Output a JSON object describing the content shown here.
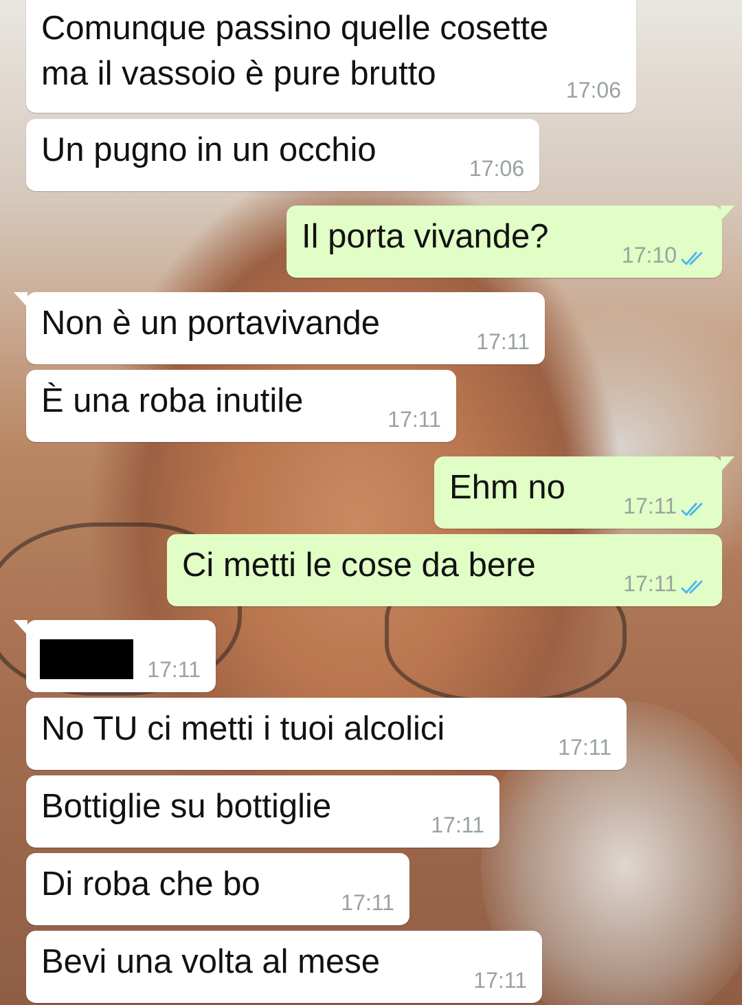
{
  "chat": {
    "colors": {
      "incoming_bubble": "#ffffff",
      "outgoing_bubble": "#e1fec6",
      "read_ticks": "#4fb6ec",
      "timestamp": "#9aa29e"
    },
    "messages": [
      {
        "direction": "in",
        "text": "Comunque passino quelle cosette\nma il vassoio è pure brutto",
        "time": "17:06"
      },
      {
        "direction": "in",
        "text": "Un pugno in un occhio",
        "time": "17:06"
      },
      {
        "direction": "out",
        "text": "Il porta vivande?",
        "time": "17:10",
        "status": "read-double-tick-icon"
      },
      {
        "direction": "in",
        "text": "Non è un portavivande",
        "time": "17:11"
      },
      {
        "direction": "in",
        "text": "È una roba inutile",
        "time": "17:11"
      },
      {
        "direction": "out",
        "text": "Ehm no",
        "time": "17:11",
        "status": "read-double-tick-icon"
      },
      {
        "direction": "out",
        "text": "Ci metti le cose da bere",
        "time": "17:11",
        "status": "read-double-tick-icon"
      },
      {
        "direction": "in",
        "text": "",
        "time": "17:11",
        "redacted": true
      },
      {
        "direction": "in",
        "text": "No TU ci metti i tuoi alcolici",
        "time": "17:11"
      },
      {
        "direction": "in",
        "text": "Bottiglie su bottiglie",
        "time": "17:11"
      },
      {
        "direction": "in",
        "text": "Di roba che bo",
        "time": "17:11"
      },
      {
        "direction": "in",
        "text": "Bevi una volta al mese",
        "time": "17:11"
      }
    ]
  }
}
